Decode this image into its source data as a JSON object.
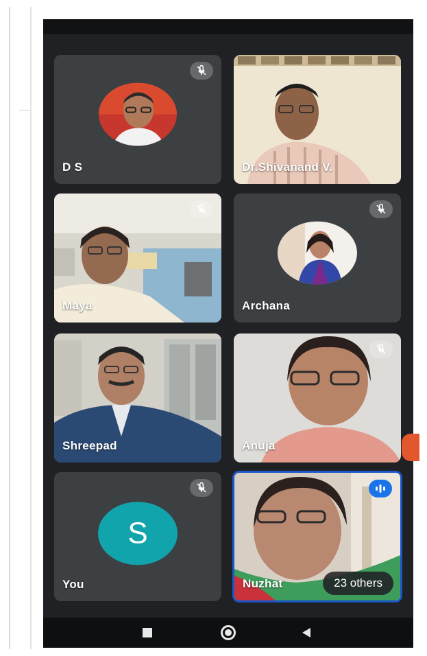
{
  "participants": [
    {
      "name": "D S",
      "muted": true,
      "kind": "photo-avatar"
    },
    {
      "name": "Dr.Shivanand V.",
      "muted": false,
      "kind": "video"
    },
    {
      "name": "Maya",
      "muted": true,
      "kind": "video"
    },
    {
      "name": "Archana",
      "muted": true,
      "kind": "photo-avatar"
    },
    {
      "name": "Shreepad",
      "muted": false,
      "kind": "video"
    },
    {
      "name": "Anuja",
      "muted": true,
      "kind": "video"
    },
    {
      "name": "You",
      "muted": true,
      "kind": "letter-avatar",
      "initial": "S",
      "avatar_color": "#12a4ad"
    },
    {
      "name": "Nuzhat",
      "muted": false,
      "kind": "video",
      "speaking": true
    }
  ],
  "others_label": "23 others",
  "icons": {
    "mic_off": "mic-off-icon",
    "speaking": "audio-level-icon",
    "nav_recents": "square-icon",
    "nav_home": "circle-icon",
    "nav_back": "triangle-back-icon"
  },
  "colors": {
    "background": "#202124",
    "tile": "#3c4043",
    "active_border": "#1a57c8",
    "speaking": "#1a73e8"
  }
}
